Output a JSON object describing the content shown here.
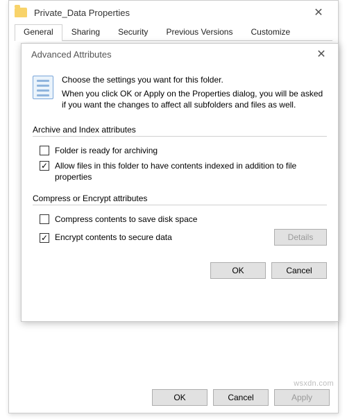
{
  "properties": {
    "title": "Private_Data Properties",
    "tabs": [
      "General",
      "Sharing",
      "Security",
      "Previous Versions",
      "Customize"
    ],
    "buttons": {
      "ok": "OK",
      "cancel": "Cancel",
      "apply": "Apply"
    }
  },
  "advanced": {
    "title": "Advanced Attributes",
    "intro1": "Choose the settings you want for this folder.",
    "intro2": "When you click OK or Apply on the Properties dialog, you will be asked if you want the changes to affect all subfolders and files as well.",
    "group1": {
      "title": "Archive and Index attributes",
      "opt1": {
        "label": "Folder is ready for archiving",
        "checked": false
      },
      "opt2": {
        "label": "Allow files in this folder to have contents indexed in addition to file properties",
        "checked": true
      }
    },
    "group2": {
      "title": "Compress or Encrypt attributes",
      "opt1": {
        "label": "Compress contents to save disk space",
        "checked": false
      },
      "opt2": {
        "label": "Encrypt contents to secure data",
        "checked": true
      },
      "details": "Details"
    },
    "buttons": {
      "ok": "OK",
      "cancel": "Cancel"
    }
  },
  "watermark": "wsxdn.com"
}
